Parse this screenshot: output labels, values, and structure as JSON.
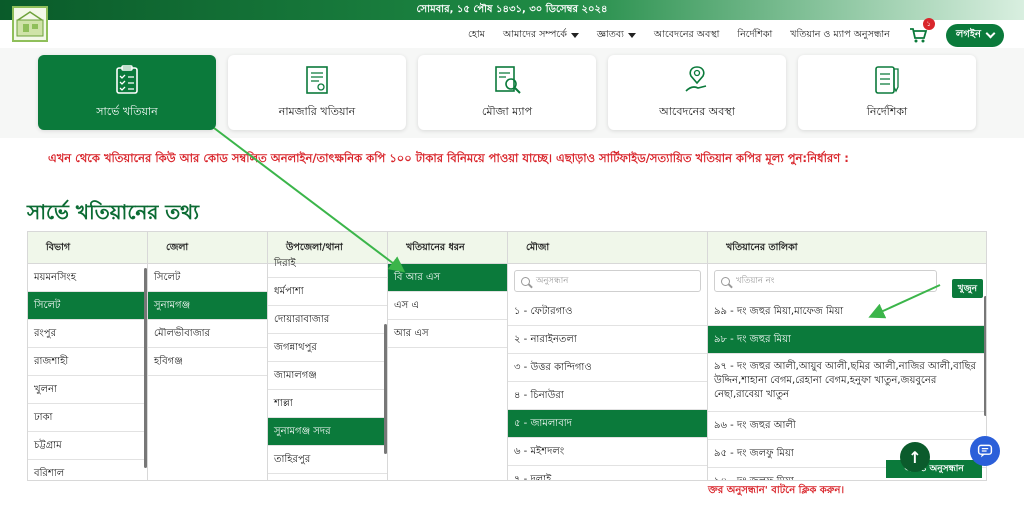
{
  "topbar": {
    "date": "সোমবার, ১৫ পৌষ ১৪৩১, ৩০ ডিসেম্বর ২০২৪"
  },
  "nav": {
    "items": [
      "হোম",
      "আমাদের সম্পর্কে",
      "জ্ঞাতব্য",
      "আবেদনের অবস্থা",
      "নির্দেশিকা",
      "খতিয়ান ও ম্যাপ অনুসন্ধান"
    ],
    "cart_count": "১",
    "login": "লগইন"
  },
  "tiles": [
    {
      "label": "সার্ভে খতিয়ান",
      "icon": "clipboard-checklist-icon"
    },
    {
      "label": "নামজারি খতিয়ান",
      "icon": "certificate-document-icon"
    },
    {
      "label": "মৌজা ম্যাপ",
      "icon": "map-search-icon"
    },
    {
      "label": "আবেদনের অবস্থা",
      "icon": "hand-location-icon"
    },
    {
      "label": "নির্দেশিকা",
      "icon": "checklist-pen-icon"
    }
  ],
  "notice": "এখন থেকে খতিয়ানের কিউ আর কোড সম্বলিত অনলাইন/তাৎক্ষনিক কপি ১০০ টাকার বিনিময়ে পাওয়া যাচ্ছে। এছাড়াও সার্টিফাইড/সত্যায়িত খতিয়ান কপির মূল্য পুন:নির্ধারণ :",
  "section_title": "সার্ভে খতিয়ানের তথ্য",
  "columns": {
    "division": {
      "header": "বিভাগ",
      "items": [
        "ময়মনসিংহ",
        "সিলেট",
        "রংপুর",
        "রাজশাহী",
        "খুলনা",
        "ঢাকা",
        "চট্টগ্রাম",
        "বরিশাল"
      ]
    },
    "district": {
      "header": "জেলা",
      "items": [
        "সিলেট",
        "সুনামগঞ্জ",
        "মৌলভীবাজার",
        "হবিগঞ্জ"
      ]
    },
    "upazila": {
      "header": "উপজেলা/থানা",
      "items": [
        "দিরাই",
        "ধর্মপাশা",
        "দোয়ারাবাজার",
        "জগন্নাথপুর",
        "জামালগঞ্জ",
        "শাল্লা",
        "সুনামগঞ্জ সদর",
        "তাহিরপুর"
      ]
    },
    "khatian_type": {
      "header": "খতিয়ানের ধরন",
      "items": [
        "বি আর এস",
        "এস এ",
        "আর এস"
      ]
    },
    "mouza": {
      "header": "মৌজা",
      "search_placeholder": "অনুসন্ধান",
      "items": [
        "১ - ফেটারগাও",
        "২ - নারাইনতলা",
        "৩ - উত্তর কান্দিগাও",
        "৪ - চিনাউরা",
        "৫ - জামলাবাদ",
        "৬ - মইশদলং",
        "৭ - দলাই"
      ]
    },
    "khatian_list": {
      "header": "খতিয়ানের তালিকা",
      "search_placeholder": "খতিয়ান নং",
      "search_button": "খুজুন",
      "items": [
        "৯৯ - দং জহুর মিয়া,মাফেজ মিয়া",
        "৯৮ - দং জহুর মিয়া",
        "৯৭ - দং জহুর আলী,আয়ুব আলী,ছমির আলী,নাজির আলী,বাছির উদ্দিন,শাহানা বেগম,রেহানা বেগম,হনুফা খাতুন,জয়বুনের নেছা,রাবেয়া খাতুন",
        "৯৬ - দং জহুর আলী",
        "৯৫ - দং জলফু মিয়া",
        "৯৪ - দং জলফু মিয়া"
      ]
    }
  },
  "advanced_button": "আরও অনুসন্ধান",
  "hint": "ক্তর অনুসন্ধান' বাটনে ক্লিক করুন।",
  "colors": {
    "primary": "#0b7a3b",
    "notice": "#d9262c",
    "arrow": "#3bb54a"
  }
}
